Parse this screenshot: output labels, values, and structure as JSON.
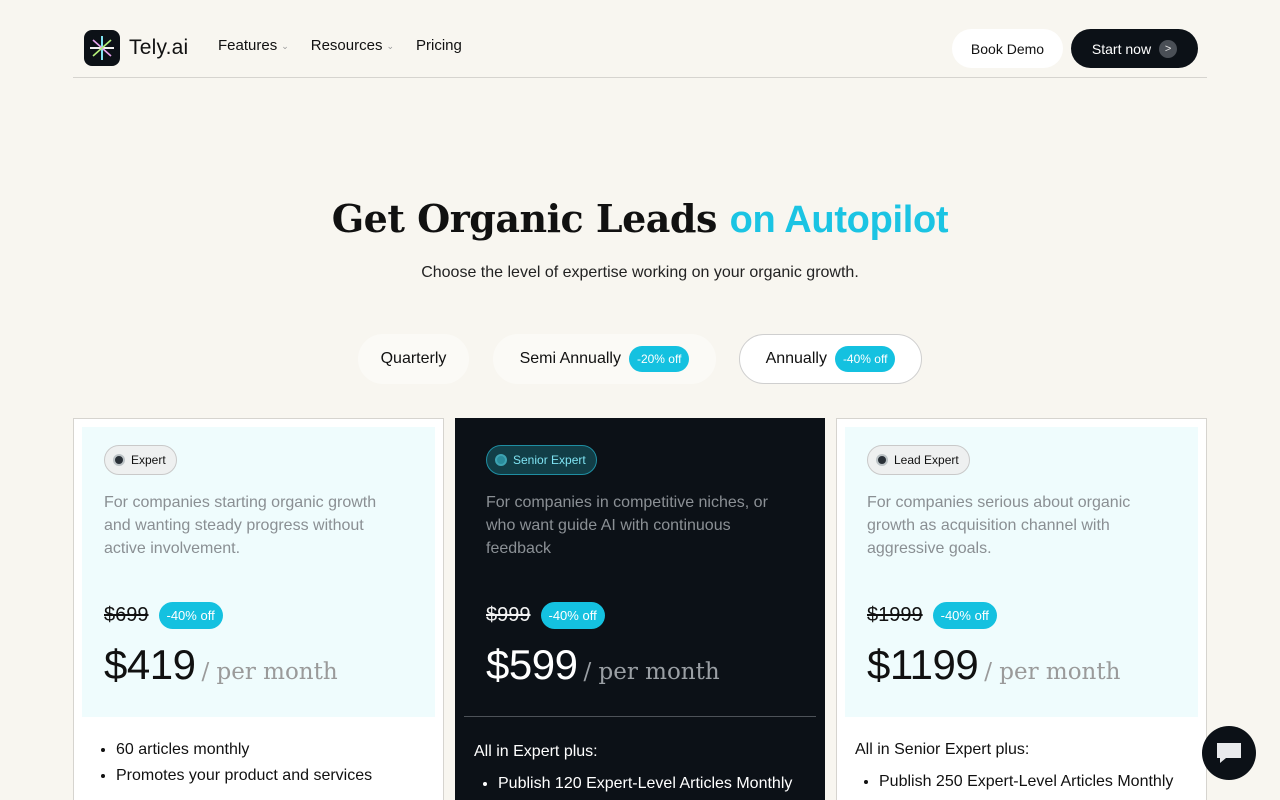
{
  "nav": {
    "brand": "Tely.ai",
    "links": [
      {
        "label": "Features",
        "has_dropdown": true
      },
      {
        "label": "Resources",
        "has_dropdown": true
      },
      {
        "label": "Pricing",
        "has_dropdown": false
      }
    ],
    "book_demo": "Book Demo",
    "start_now": "Start now",
    "start_arrow": ">"
  },
  "hero": {
    "title_main": "Get Organic Leads",
    "title_accent": "on Autopilot",
    "subtitle": "Choose the level of expertise working on your organic growth."
  },
  "billing": {
    "options": [
      {
        "label": "Quarterly",
        "badge": ""
      },
      {
        "label": "Semi Annually",
        "badge": "-20% off"
      },
      {
        "label": "Annually",
        "badge": "-40% off"
      }
    ],
    "selected": "Annually"
  },
  "plans": [
    {
      "tier": "Expert",
      "description": "For companies starting organic growth and wanting steady progress without active involvement.",
      "old_price": "$699",
      "discount": "-40% off",
      "price": "$419",
      "period": "/ per month",
      "plus_title": "",
      "features": [
        "60 articles monthly",
        "Promotes your product and services"
      ]
    },
    {
      "tier": "Senior Expert",
      "description": "For companies in competitive niches, or who want guide AI with continuous feedback",
      "old_price": "$999",
      "discount": "-40% off",
      "price": "$599",
      "period": "/ per month",
      "plus_title": "All in Expert plus:",
      "features": [
        "Publish 120 Expert-Level Articles Monthly"
      ]
    },
    {
      "tier": "Lead Expert",
      "description": "For companies serious about organic growth as acquisition channel with aggressive goals.",
      "old_price": "$1999",
      "discount": "-40% off",
      "price": "$1199",
      "period": "/ per month",
      "plus_title": "All in Senior Expert plus:",
      "features": [
        "Publish 250 Expert-Level Articles Monthly"
      ]
    }
  ],
  "colors": {
    "background": "#f8f6f0",
    "accent": "#14c1e0",
    "dark": "#0c1117",
    "card_tint": "#effcfd"
  },
  "icons": {
    "chat": "chat-bubble-icon",
    "dropdown": "chevron-down-icon",
    "arrow": "arrow-right-icon"
  }
}
